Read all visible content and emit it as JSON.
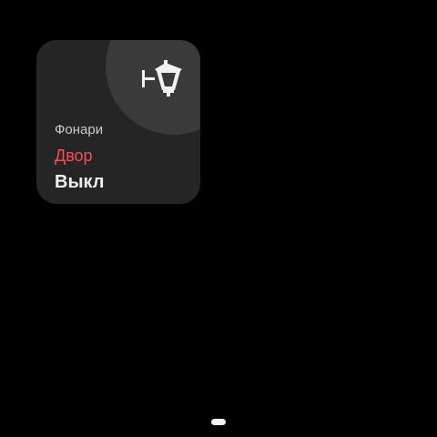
{
  "tile": {
    "group": "Фонари",
    "device": "Двор",
    "state": "Выкл",
    "icon": "street-lamp-icon",
    "accent_color": "#ff4b4b"
  },
  "navigation": {
    "home_indicator": "nav-pill"
  }
}
